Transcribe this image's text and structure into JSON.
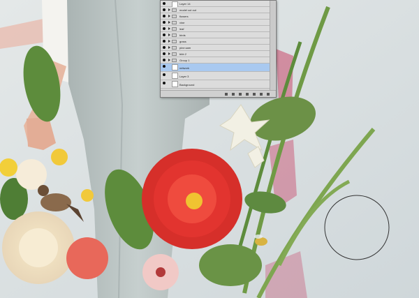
{
  "layers_panel": {
    "rows": [
      {
        "label": "Layer 14",
        "kind": "layer",
        "selected": false
      },
      {
        "label": "model cut out",
        "kind": "group",
        "selected": false
      },
      {
        "label": "flowers",
        "kind": "group",
        "selected": false
      },
      {
        "label": "vine",
        "kind": "group",
        "selected": false
      },
      {
        "label": "leaf",
        "kind": "group",
        "selected": false
      },
      {
        "label": "birds",
        "kind": "group",
        "selected": false
      },
      {
        "label": "grass",
        "kind": "group",
        "selected": false
      },
      {
        "label": "pine.sam",
        "kind": "group",
        "selected": false
      },
      {
        "label": "bbb 2",
        "kind": "group",
        "selected": false
      },
      {
        "label": "Group 1",
        "kind": "group",
        "selected": false
      },
      {
        "label": "network",
        "kind": "layer",
        "selected": true
      },
      {
        "label": "Layer 3",
        "kind": "layer",
        "selected": false
      },
      {
        "label": "Background",
        "kind": "layer",
        "selected": false
      }
    ]
  },
  "colors": {
    "wall": "#d9dfe1",
    "pants": "#b9c3c2",
    "dahlia_red": "#e2342f",
    "leaf_green": "#5d8c3c",
    "rose_cream": "#f4ead7",
    "pink_brush": "#c9486a",
    "selection_blue": "#a9c9f0"
  },
  "icons": [
    "eye-icon",
    "folder-icon",
    "triangle-icon",
    "brush-circle-icon"
  ]
}
